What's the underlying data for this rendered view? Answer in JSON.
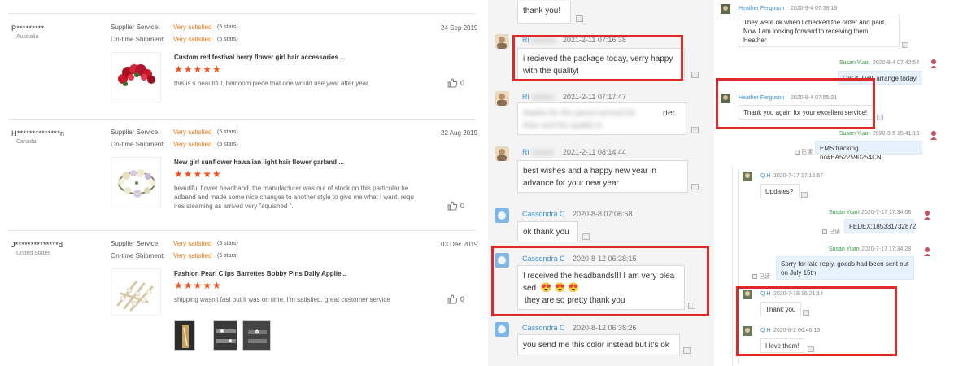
{
  "reviews": {
    "labels": {
      "supplier_service": "Supplier Service:",
      "shipment": "On-time Shipment:"
    },
    "items": [
      {
        "user": "P*********",
        "country": "Australia",
        "supplier_rating": "Very satisfied",
        "supplier_stars": "(5 stars)",
        "shipment_rating": "Very satisfied",
        "shipment_stars": "(5 stars)",
        "date": "24 Sep 2019",
        "product": "Custom red festival berry flower girl hair accessories ...",
        "stars": "★★★★★",
        "rating": 5,
        "text": "this is s beautiful, heirloom piece that one would use year after year.",
        "likes": "0"
      },
      {
        "user": "H**************n",
        "country": "Canada",
        "supplier_rating": "Very satisfied",
        "supplier_stars": "(5 stars)",
        "shipment_rating": "Very satisfied",
        "shipment_stars": "(5 stars)",
        "date": "22 Aug 2019",
        "product": "New girl sunflower hawaiian light hair flower garland ...",
        "stars": "★★★★★",
        "rating": 5,
        "text": "beautiful flower headband. the manufacturer was out of stock on this particular he adband and made some nice changes to another style to give me what I want. requ ires steaming as arrived very \"squished \".",
        "likes": "0"
      },
      {
        "user": "J**************d",
        "country": "United States",
        "supplier_rating": "Very satisfied",
        "supplier_stars": "(5 stars)",
        "shipment_rating": "Very satisfied",
        "shipment_stars": "(5 stars)",
        "date": "03 Dec 2019",
        "product": "Fashion Pearl Clips Barrettes Bobby Pins Daily Applie...",
        "stars": "★★★★★",
        "rating": 5,
        "text": "shipping wasn't fast but it was on time. I'm satisfied. great customer service",
        "likes": "0"
      }
    ]
  },
  "chat": {
    "messages": [
      {
        "name": "",
        "time": "",
        "text": "thank you!"
      },
      {
        "name": "Ri",
        "time": "2021-2-11 07:16:38",
        "text": "i recieved the package today, verry happy with the quality!"
      },
      {
        "name": "Ri",
        "time": "2021-2-11 07:17:47",
        "text": "rter",
        "text_blur": "thanks for the parcel arrived thr"
      },
      {
        "name": "Ri",
        "time": "2021-2-11 08:14:44",
        "text": "best wishes and a happy new year in advance for your new year"
      },
      {
        "name": "Cassondra C",
        "time": "2020-8-8 07:06:58",
        "text": "ok thank you"
      },
      {
        "name": "Cassondra C",
        "time": "2020-8-12 06:38:15",
        "text_line1": "I received the headbands!!! I am very plea",
        "text_line2": "sed",
        "emojis": "😍 😍 😍",
        "text_line3": "they are so pretty thank you"
      },
      {
        "name": "Cassondra C",
        "time": "2020-8-12 06:38:26",
        "text": "you send me this color instead but it's ok"
      }
    ]
  },
  "conv1": {
    "m1": {
      "name": "Heather Ferguson",
      "time": "2020-9-4 07:39:19",
      "text": "They were ok when I checked the order and paid. Now I am looking forward to receiving them. Heather"
    },
    "m2": {
      "name": "Susan Yuan",
      "time": "2020-9-4 07:42:54",
      "text": "Got it, I will arrange today"
    },
    "m3": {
      "name": "Heather Ferguson",
      "time": "2020-9-4 07:55:21",
      "text": "Thank you again for your excellent service!"
    },
    "m4": {
      "name": "Susan Yuan",
      "time": "2020-9-5 15:41:19",
      "read": "已读",
      "text": "EMS tracking no#EA522590254CN"
    }
  },
  "conv2": {
    "m1": {
      "name": "Q H",
      "time": "2020-7-17 17:16:57",
      "text": "Updates?"
    },
    "m2": {
      "name": "Susan Yuan",
      "time": "2020-7-17 17:34:08",
      "read": "已读",
      "text": "FEDEX:185331732872"
    },
    "m3": {
      "name": "Susan Yuan",
      "time": "2020-7-17 17:34:28",
      "read": "已读",
      "text": "Sorry for late reply, goods had been sent out on July 15th"
    },
    "m4": {
      "name": "Q H",
      "time": "2020-7-18 16:21:14",
      "text": "Thank you"
    },
    "m5": {
      "name": "Q H",
      "time": "2020-8-2 06:46:13",
      "text": "I love them!"
    }
  },
  "colors": {
    "highlight": "#e12828",
    "rating_orange": "#e8730f",
    "star_red": "#f4511e",
    "link_blue": "#3b8fd4",
    "seller_green": "#2f9f3f"
  }
}
